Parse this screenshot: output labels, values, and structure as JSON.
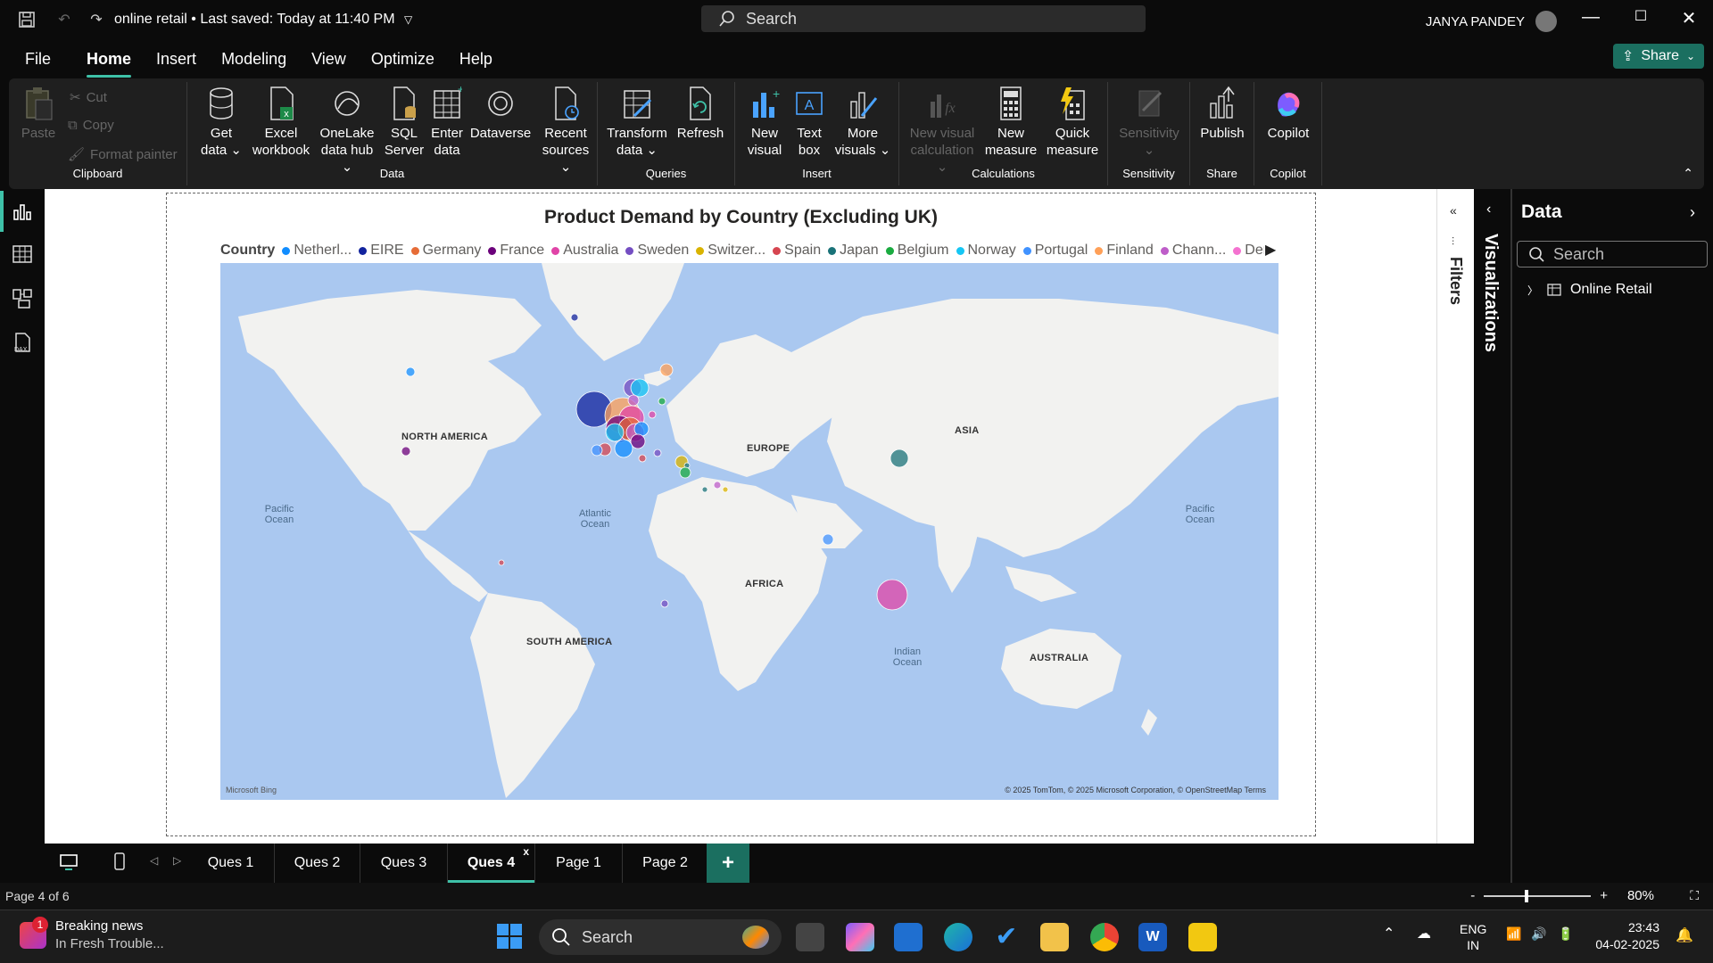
{
  "window": {
    "doc_title": "online retail",
    "save_status": "Last saved: Today at 11:40 PM",
    "search_placeholder": "Search",
    "user_name": "JANYA PANDEY"
  },
  "menu": {
    "items": [
      "File",
      "Home",
      "Insert",
      "Modeling",
      "View",
      "Optimize",
      "Help"
    ],
    "active": "Home",
    "share_label": "Share"
  },
  "ribbon": {
    "clipboard": {
      "paste": "Paste",
      "cut": "Cut",
      "copy": "Copy",
      "format_painter": "Format painter",
      "group": "Clipboard"
    },
    "data": {
      "get_data": [
        "Get",
        "data"
      ],
      "excel": [
        "Excel",
        "workbook"
      ],
      "onelake": [
        "OneLake",
        "data hub"
      ],
      "sql": [
        "SQL",
        "Server"
      ],
      "enter": [
        "Enter",
        "data"
      ],
      "dataverse": "Dataverse",
      "recent": [
        "Recent",
        "sources"
      ],
      "group": "Data"
    },
    "queries": {
      "transform": [
        "Transform",
        "data"
      ],
      "refresh": "Refresh",
      "group": "Queries"
    },
    "insert": {
      "new_visual": [
        "New",
        "visual"
      ],
      "text_box": [
        "Text",
        "box"
      ],
      "more_visuals": [
        "More",
        "visuals"
      ],
      "group": "Insert"
    },
    "calculations": {
      "new_visual_calc": [
        "New visual",
        "calculation"
      ],
      "new_measure": [
        "New",
        "measure"
      ],
      "quick_measure": [
        "Quick",
        "measure"
      ],
      "group": "Calculations"
    },
    "sensitivity": {
      "label": "Sensitivity",
      "group": "Sensitivity"
    },
    "share": {
      "publish": "Publish",
      "group": "Share"
    },
    "copilot": {
      "label": "Copilot",
      "group": "Copilot"
    }
  },
  "visual": {
    "title": "Product Demand by Country (Excluding UK)",
    "legend_title": "Country",
    "legend": [
      {
        "name": "Netherl...",
        "color": "#118dff"
      },
      {
        "name": "EIRE",
        "color": "#12239e"
      },
      {
        "name": "Germany",
        "color": "#e66c37"
      },
      {
        "name": "France",
        "color": "#6b007b"
      },
      {
        "name": "Australia",
        "color": "#e044a7"
      },
      {
        "name": "Sweden",
        "color": "#744ec2"
      },
      {
        "name": "Switzer...",
        "color": "#d9b300"
      },
      {
        "name": "Spain",
        "color": "#d64550"
      },
      {
        "name": "Japan",
        "color": "#197278"
      },
      {
        "name": "Belgium",
        "color": "#1aab40"
      },
      {
        "name": "Norway",
        "color": "#15c6f4"
      },
      {
        "name": "Portugal",
        "color": "#4092ff"
      },
      {
        "name": "Finland",
        "color": "#ffa058"
      },
      {
        "name": "Chann...",
        "color": "#be5dc9"
      },
      {
        "name": "Denm...",
        "color": "#f472d0"
      }
    ],
    "map_labels": {
      "north_america": "NORTH AMERICA",
      "europe": "EUROPE",
      "asia": "ASIA",
      "africa": "AFRICA",
      "south_america": "SOUTH AMERICA",
      "australia": "AUSTRALIA",
      "pacific_w": "Pacific Ocean",
      "pacific_e": "Pacific Ocean",
      "atlantic": "Atlantic Ocean",
      "indian": "Indian Ocean"
    },
    "copyright": "© 2025 TomTom, © 2025 Microsoft Corporation, © OpenStreetMap  Terms",
    "bing": "Microsoft Bing"
  },
  "panes": {
    "filters": "Filters",
    "visualizations": "Visualizations",
    "data_title": "Data",
    "data_search": "Search",
    "table": "Online Retail"
  },
  "pages": {
    "tabs": [
      "Ques 1",
      "Ques 2",
      "Ques 3",
      "Ques 4",
      "Page 1",
      "Page 2"
    ],
    "active": "Ques 4",
    "status": "Page 4 of 6",
    "zoom": "80%"
  },
  "taskbar": {
    "news_title": "Breaking news",
    "news_sub": "In Fresh Trouble...",
    "news_badge": "1",
    "search": "Search",
    "lang": "ENG",
    "region": "IN",
    "time": "23:43",
    "date": "04-02-2025"
  }
}
